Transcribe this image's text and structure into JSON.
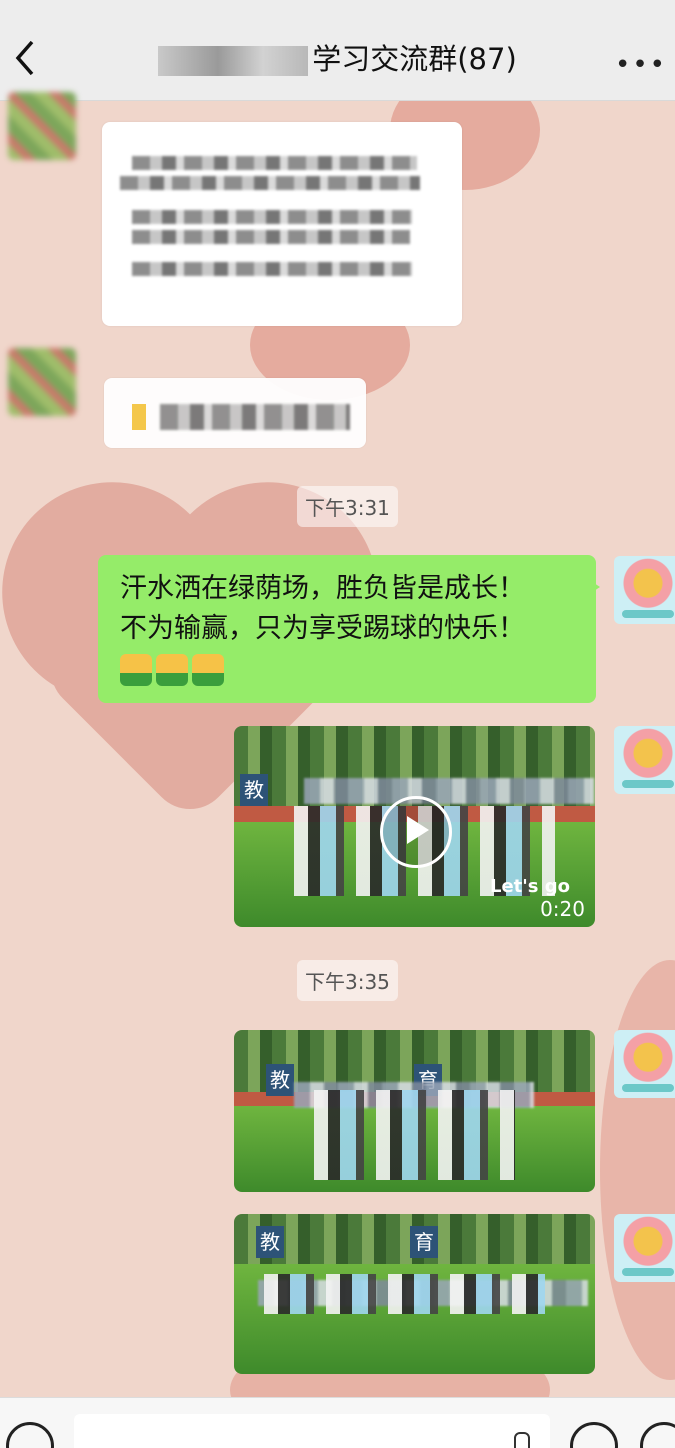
{
  "header": {
    "title": "学习交流群(87)",
    "title_prefix_masked": "5级7.1",
    "back_icon": "chevron-left-icon",
    "more_icon": "more-horizontal-icon"
  },
  "timestamps": [
    "下午3:31",
    "下午3:35"
  ],
  "messages": {
    "self_text": {
      "lines": [
        "汗水洒在绿荫场，胜负皆是成长！",
        "不为输赢，只为享受踢球的快乐！"
      ],
      "emoji": [
        "thumbs-up-icon",
        "thumbs-up-icon",
        "thumbs-up-icon"
      ]
    },
    "video": {
      "duration": "0:20",
      "overlay_text": "Let's go",
      "sign_char": "教"
    },
    "photo1": {
      "signs": [
        "教",
        "育"
      ]
    },
    "photo2": {
      "signs": [
        "教",
        "育"
      ]
    }
  },
  "bottom_bar": {
    "voice_icon": "voice-icon",
    "mic_icon": "microphone-icon",
    "emoji_icon": "emoji-icon",
    "plus_icon": "plus-icon"
  },
  "colors": {
    "bubble_green": "#95ec69",
    "header_bg": "#ededed",
    "wallpaper": "#f0d6cb"
  }
}
